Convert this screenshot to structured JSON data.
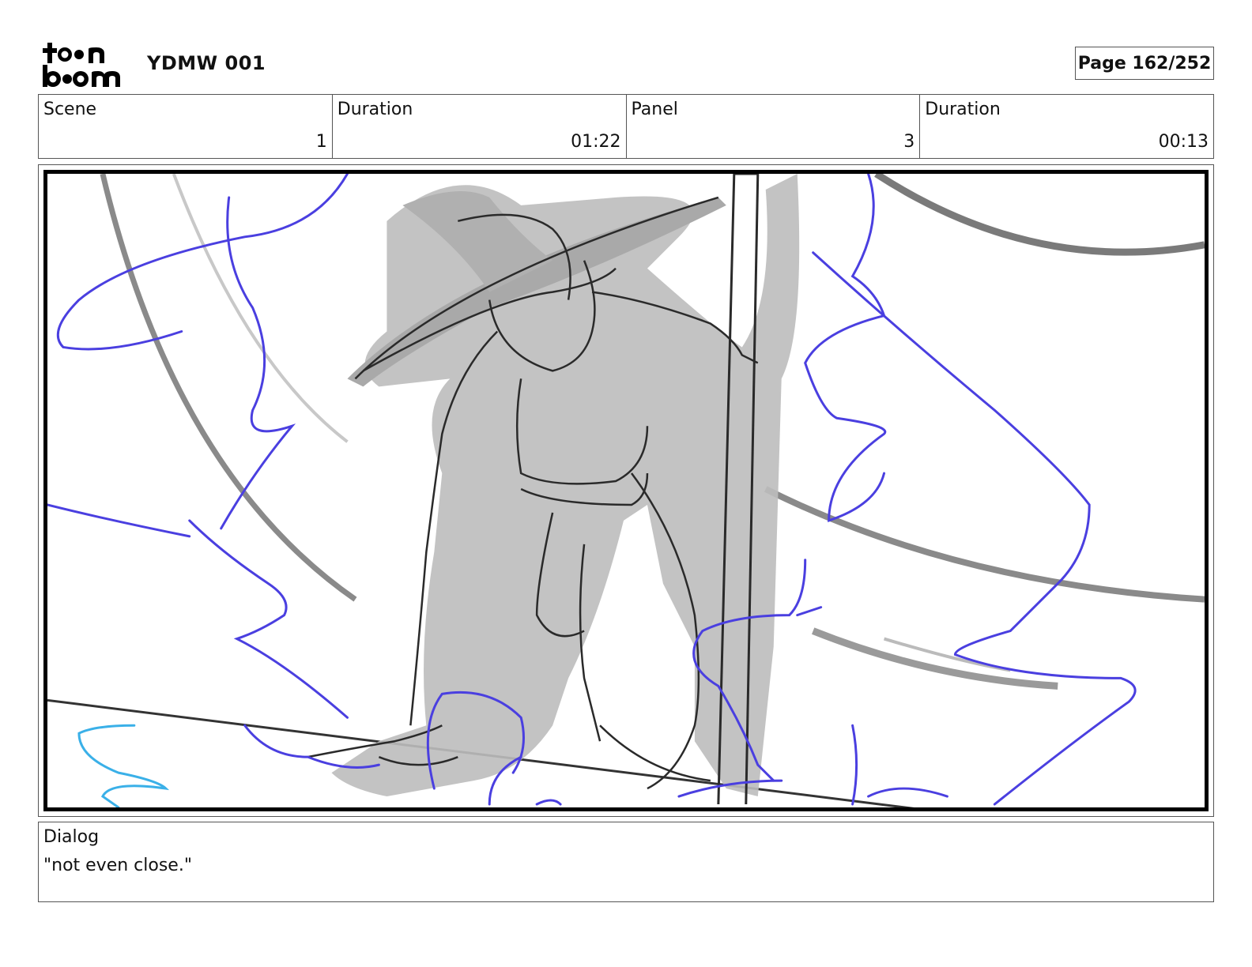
{
  "header": {
    "project_title": "YDMW 001",
    "page_label": "Page 162/252",
    "logo_icon": "toon-boom-logo"
  },
  "info": {
    "scene_label": "Scene",
    "scene_value": "1",
    "scene_duration_label": "Duration",
    "scene_duration_value": "01:22",
    "panel_label": "Panel",
    "panel_value": "3",
    "panel_duration_label": "Duration",
    "panel_duration_value": "00:13"
  },
  "panel": {
    "image": "storyboard-sketch-witch-kneeling-with-staff",
    "colors": {
      "sketch_gray": "#bdbdbd",
      "line_dark": "#2a2a2a",
      "energy_blue": "#4a3fe0",
      "water_cyan": "#3ab0e8"
    }
  },
  "dialog": {
    "label": "Dialog",
    "text": "\"not even close.\""
  }
}
